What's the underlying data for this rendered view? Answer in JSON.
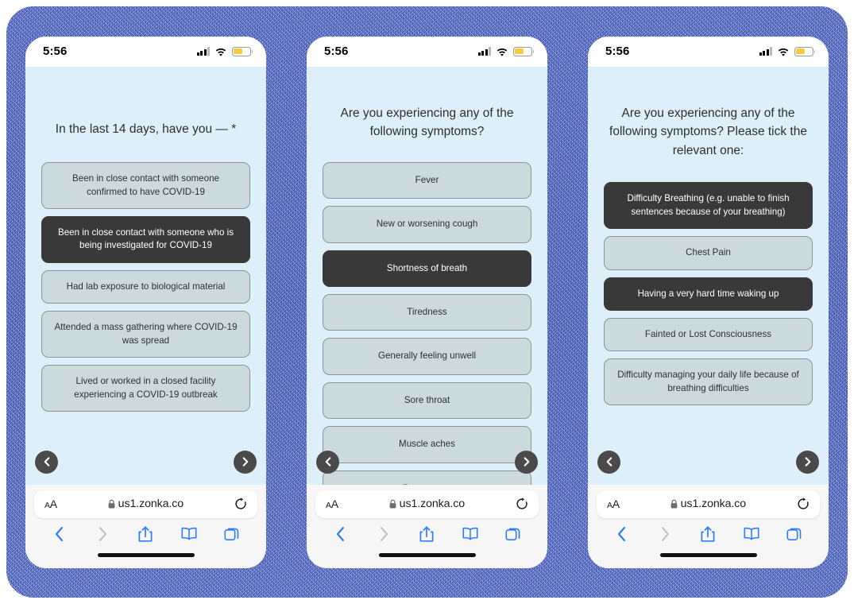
{
  "frame": {
    "color": "#4f6bc4"
  },
  "theme": {
    "page_bg": "#ddf0fa",
    "option_bg": "#ccdade",
    "option_border": "#8d9598",
    "option_selected_bg": "#393939",
    "option_selected_text": "#ffffff",
    "text": "#2e2e2e",
    "ios_blue": "#2c7cf6",
    "battery_fill": "#f7cb3f"
  },
  "status_bar": {
    "time": "5:56",
    "signal_icon": "signal-bars-icon",
    "wifi_icon": "wifi-icon",
    "battery_icon": "battery-icon"
  },
  "safari": {
    "text_size_label": "ᴀA",
    "url": "us1.zonka.co",
    "lock_icon": "lock-icon",
    "reload_icon": "reload-icon",
    "back_icon": "chevron-left-icon",
    "forward_icon": "chevron-right-icon",
    "share_icon": "share-icon",
    "bookmarks_icon": "book-icon",
    "tabs_icon": "tabs-icon"
  },
  "survey_nav": {
    "prev_icon": "chevron-left-icon",
    "next_icon": "chevron-right-icon",
    "prev_label": "Previous question",
    "next_label": "Next question"
  },
  "screens": [
    {
      "id": "screen-exposure",
      "question": "In the last 14 days, have you — *",
      "options": [
        {
          "label": "Been in close contact with someone confirmed to have COVID-19",
          "selected": false
        },
        {
          "label": "Been in close contact with someone who is being investigated for COVID-19",
          "selected": true
        },
        {
          "label": "Had lab exposure to biological material",
          "selected": false
        },
        {
          "label": "Attended a mass gathering where COVID-19 was spread",
          "selected": false
        },
        {
          "label": "Lived or worked in a closed facility experiencing a COVID-19 outbreak",
          "selected": false
        }
      ]
    },
    {
      "id": "screen-symptoms",
      "question": "Are you experiencing any of the following symptoms?",
      "options": [
        {
          "label": "Fever",
          "selected": false
        },
        {
          "label": "New or worsening cough",
          "selected": false
        },
        {
          "label": "Shortness of breath",
          "selected": true
        },
        {
          "label": "Tiredness",
          "selected": false
        },
        {
          "label": "Generally feeling unwell",
          "selected": false
        },
        {
          "label": "Sore throat",
          "selected": false
        },
        {
          "label": "Muscle aches",
          "selected": false
        },
        {
          "label": "Runny nose",
          "selected": false
        }
      ]
    },
    {
      "id": "screen-severe-symptoms",
      "question": "Are you experiencing any of the following symptoms? Please tick the relevant one:",
      "options": [
        {
          "label": "Difficulty Breathing (e.g. unable to finish sentences because of your breathing)",
          "selected": true
        },
        {
          "label": "Chest Pain",
          "selected": false
        },
        {
          "label": "Having a very hard time waking up",
          "selected": true
        },
        {
          "label": "Fainted or Lost Consciousness",
          "selected": false
        },
        {
          "label": "Difficulty managing your daily life because of breathing difficulties",
          "selected": false
        }
      ]
    }
  ]
}
